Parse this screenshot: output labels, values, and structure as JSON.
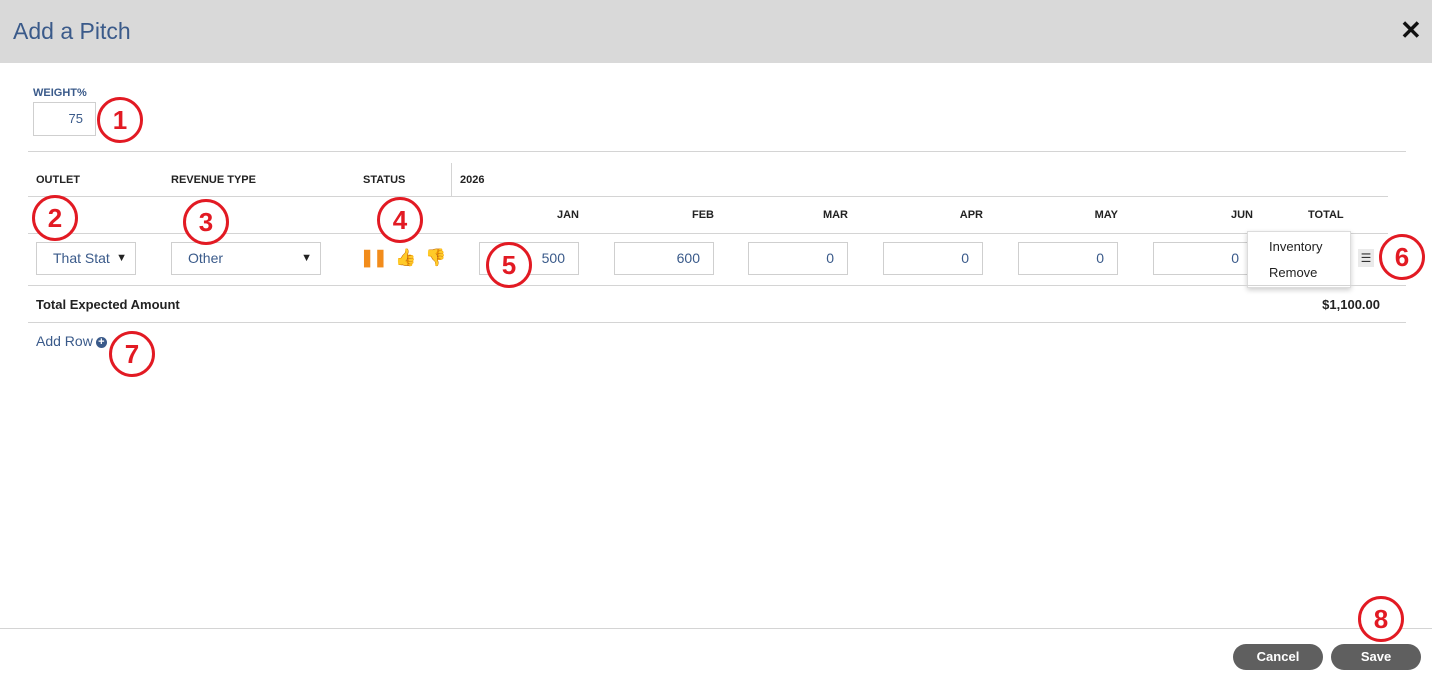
{
  "header": {
    "title": "Add a Pitch",
    "close_glyph": "✕"
  },
  "weight": {
    "label": "WEIGHT%",
    "value": "75"
  },
  "table": {
    "headers": {
      "outlet": "OUTLET",
      "revenue_type": "REVENUE TYPE",
      "status": "STATUS",
      "year": "2026"
    },
    "months": [
      "JAN",
      "FEB",
      "MAR",
      "APR",
      "MAY",
      "JUN"
    ],
    "total_header": "TOTAL",
    "row": {
      "outlet": "That Stat",
      "revenue_type": "Other",
      "status_icons": [
        "pause-icon",
        "thumbs-up-icon",
        "thumbs-down-icon"
      ],
      "amounts": [
        "500",
        "600",
        "0",
        "0",
        "0",
        "0"
      ]
    },
    "total_label": "Total Expected Amount",
    "total_value": "$1,100.00"
  },
  "add_row_label": "Add Row",
  "row_menu": {
    "items": [
      "Inventory",
      "Remove"
    ]
  },
  "footer": {
    "cancel_label": "Cancel",
    "save_label": "Save"
  },
  "annotations": [
    "1",
    "2",
    "3",
    "4",
    "5",
    "6",
    "7",
    "8"
  ],
  "colors": {
    "title": "#3a5a8a",
    "header_bg": "#d9d9d9",
    "annotation": "#e21a23",
    "pause": "#f28c1b",
    "button": "#5f5f5f"
  }
}
